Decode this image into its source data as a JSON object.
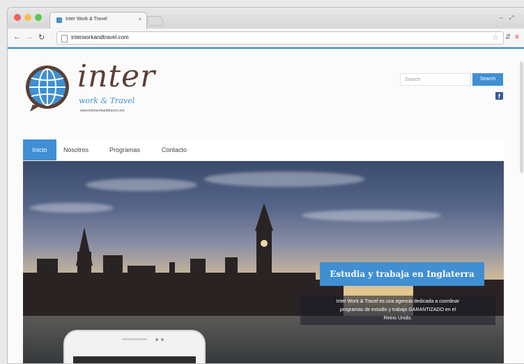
{
  "browser": {
    "tab_title": "Inter Work & Travel",
    "tab_close": "×",
    "url": "interworkandtravel.com",
    "controls": {
      "minimize": "–",
      "restore": "⤢"
    }
  },
  "site": {
    "logo_word": "inter",
    "logo_tagline": "work & Travel",
    "logo_url": "www.interworkandtravel.com",
    "search": {
      "placeholder": "Search",
      "button": "Search"
    },
    "facebook_letter": "f",
    "menu": [
      {
        "label": "Inicio",
        "active": true
      },
      {
        "label": "Nosotros",
        "active": false
      },
      {
        "label": "Programas",
        "active": false
      },
      {
        "label": "Contacto",
        "active": false
      }
    ],
    "hero": {
      "title": "Estudia y trabaja en Inglaterra",
      "description_lines": [
        "Inter Work & Travel es una agencia dedicada a coordinar",
        "programas de estudio y trabajo GARANTIZADO en el",
        "Reino Unido."
      ]
    }
  },
  "colors": {
    "accent": "#3f8fd2",
    "logo_brown": "#5a4035",
    "facebook": "#3b5998"
  }
}
